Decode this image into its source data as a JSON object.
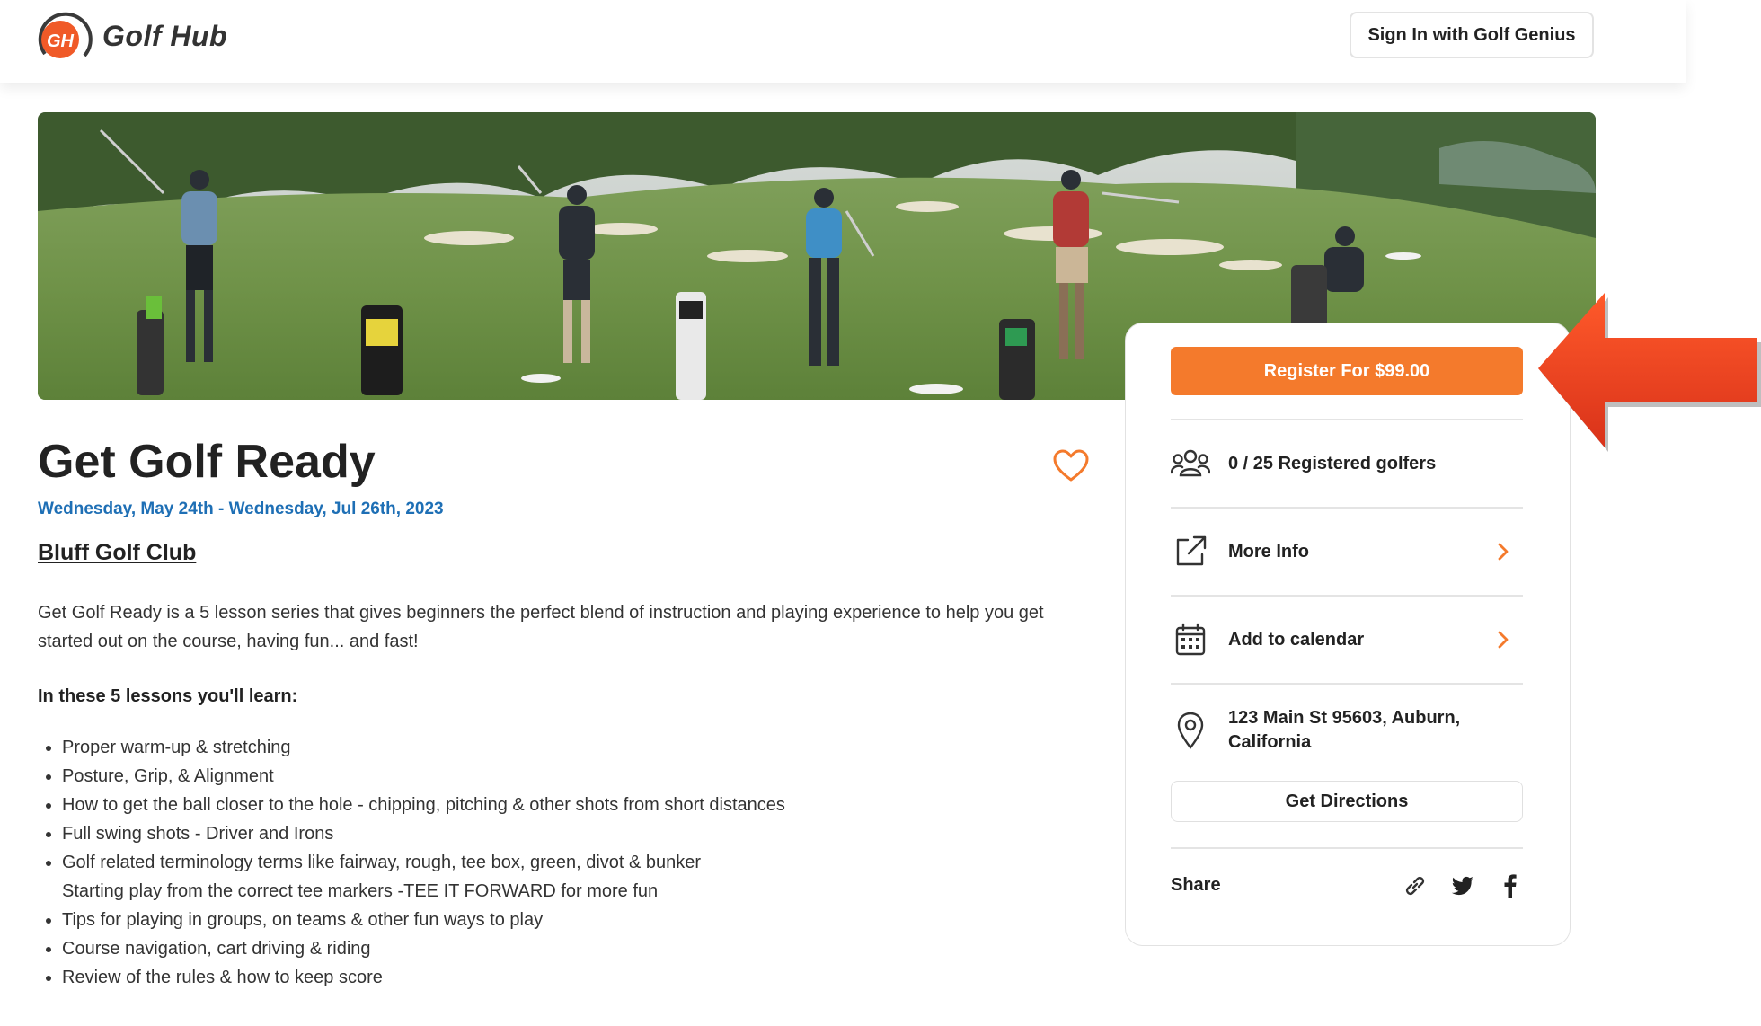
{
  "header": {
    "logo_text": "GH",
    "brand": "Golf Hub",
    "signin_label": "Sign In with Golf Genius"
  },
  "event": {
    "title": "Get Golf Ready",
    "dates": "Wednesday, May 24th - Wednesday, Jul 26th, 2023",
    "club": "Bluff Golf Club",
    "description": "Get Golf Ready is a 5 lesson series that gives beginners the perfect blend of instruction and playing experience to help you get started out on the course, having fun... and fast!",
    "lessons_heading": "In these 5 lessons you'll learn:",
    "lessons": [
      "Proper warm-up & stretching",
      "Posture, Grip, & Alignment",
      "How to get the ball closer to the hole - chipping, pitching & other shots from short distances",
      "Full swing shots - Driver and Irons",
      "Golf related terminology terms like fairway, rough, tee box, green, divot & bunker",
      "Starting play from the correct tee markers -TEE IT FORWARD for more fun",
      "Tips for playing in groups, on teams & other fun ways to play",
      "Course navigation, cart driving & riding",
      "Review of the rules & how to keep score"
    ]
  },
  "sidebar": {
    "register_label": "Register For $99.00",
    "registered": "0 / 25 Registered golfers",
    "more_info": "More Info",
    "add_calendar": "Add to calendar",
    "address": "123 Main St 95603, Auburn, California",
    "directions_label": "Get Directions",
    "share_label": "Share"
  },
  "icons": {
    "favorite": "heart-icon",
    "golfers": "users-icon",
    "more_info": "external-link-icon",
    "calendar": "calendar-icon",
    "location": "map-pin-icon",
    "share_link": "link-icon",
    "share_twitter": "twitter-icon",
    "share_facebook": "facebook-icon",
    "chevron": "chevron-right-icon"
  },
  "colors": {
    "accent": "#f47a2c",
    "date_blue": "#1e6fb5",
    "annotation_arrow": "#e8401c"
  }
}
